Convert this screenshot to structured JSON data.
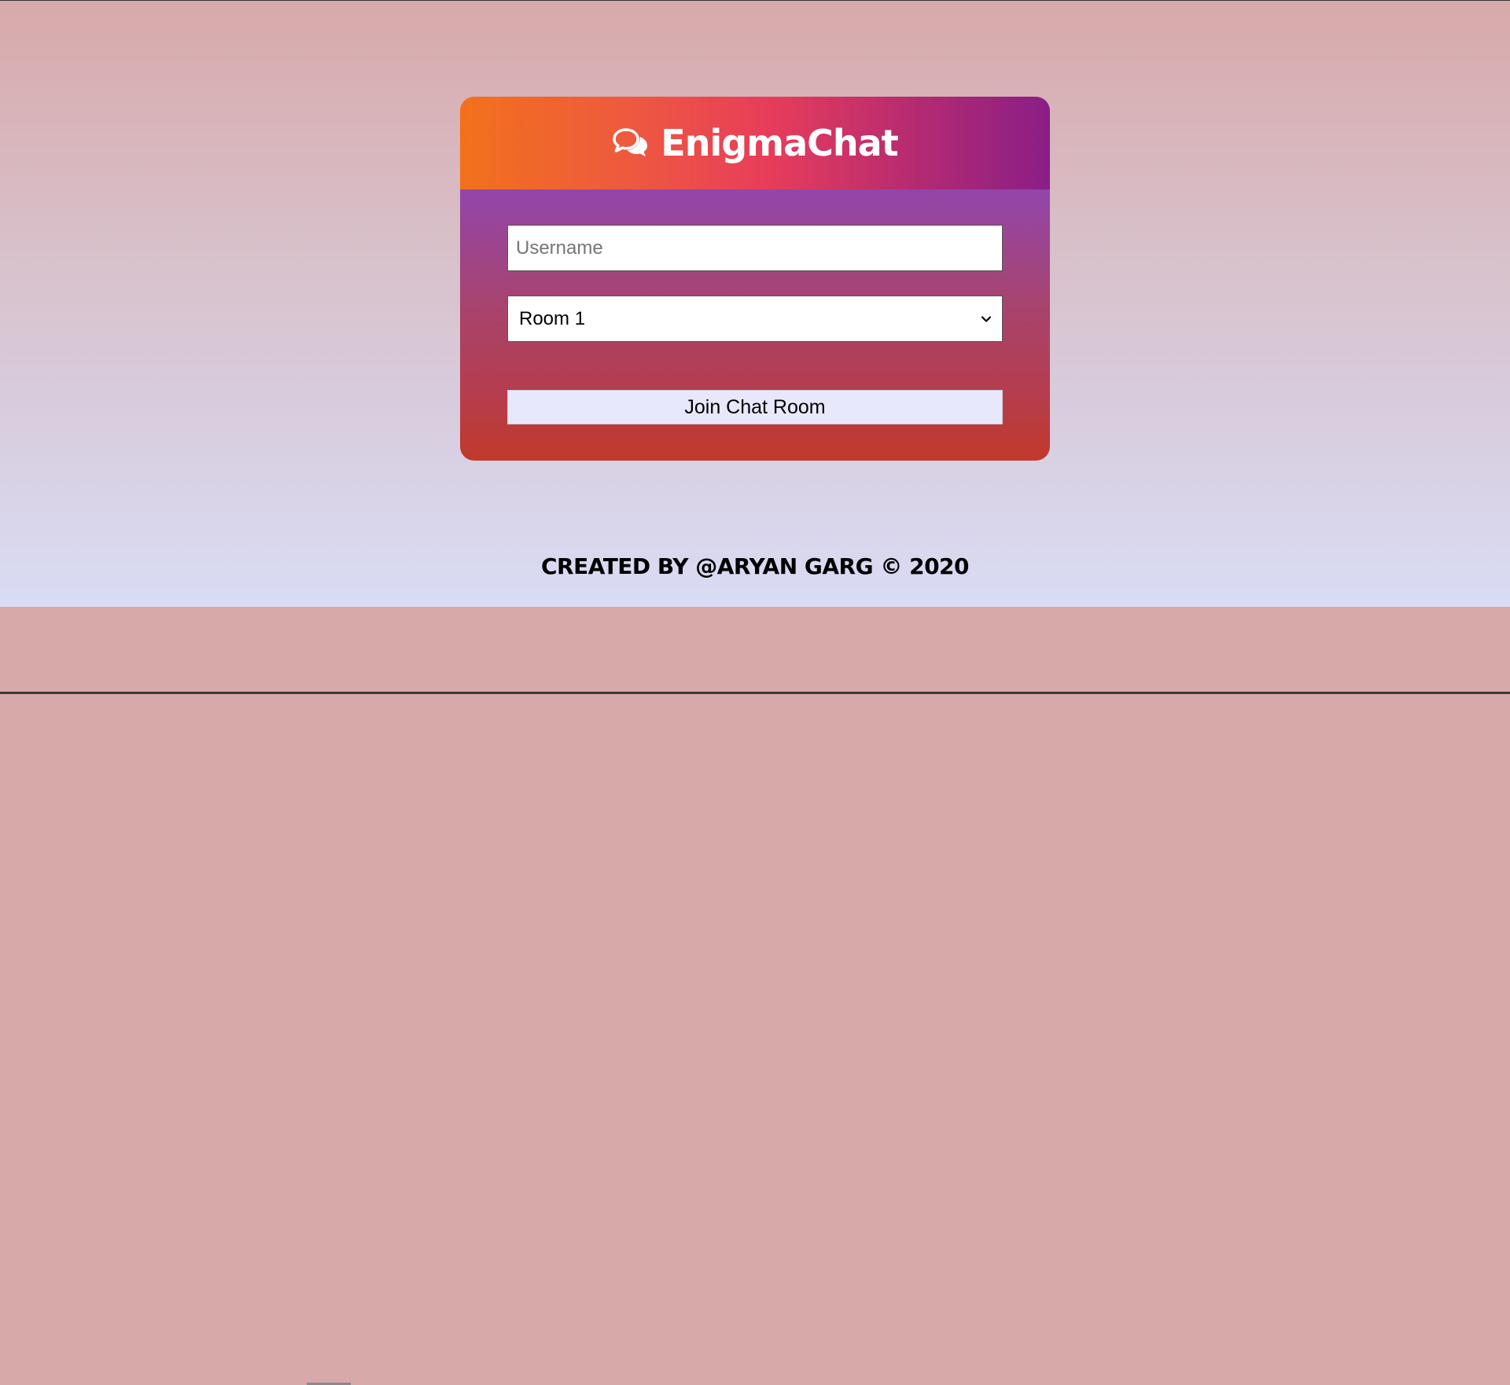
{
  "header": {
    "brand_title": "EnigmaChat",
    "brand_icon": "comments-icon"
  },
  "form": {
    "username": {
      "placeholder": "Username",
      "value": ""
    },
    "room": {
      "selected": "Room 1",
      "options": [
        "Room 1"
      ]
    },
    "join_button_label": "Join Chat Room"
  },
  "footer": {
    "credit": "CREATED BY @ARYAN GARG © 2020"
  },
  "colors": {
    "header_gradient": [
      "#f2711c",
      "#e83d5a",
      "#8a1e86"
    ],
    "body_gradient": [
      "#9246ab",
      "#c1392b"
    ],
    "page_background_top": "#d8a9aa",
    "page_background_bottom": "#d9dcf5",
    "button_background": "#e8e8fd"
  }
}
